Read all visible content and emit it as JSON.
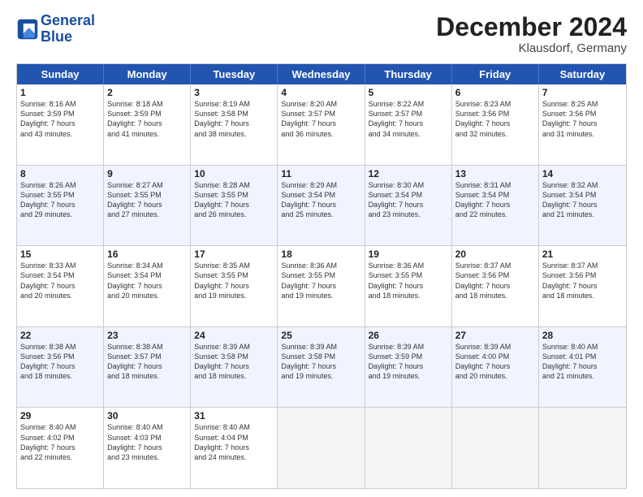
{
  "header": {
    "logo_line1": "General",
    "logo_line2": "Blue",
    "title": "December 2024",
    "subtitle": "Klausdorf, Germany"
  },
  "weekdays": [
    "Sunday",
    "Monday",
    "Tuesday",
    "Wednesday",
    "Thursday",
    "Friday",
    "Saturday"
  ],
  "rows": [
    [
      {
        "day": "1",
        "l1": "Sunrise: 8:16 AM",
        "l2": "Sunset: 3:59 PM",
        "l3": "Daylight: 7 hours",
        "l4": "and 43 minutes."
      },
      {
        "day": "2",
        "l1": "Sunrise: 8:18 AM",
        "l2": "Sunset: 3:59 PM",
        "l3": "Daylight: 7 hours",
        "l4": "and 41 minutes."
      },
      {
        "day": "3",
        "l1": "Sunrise: 8:19 AM",
        "l2": "Sunset: 3:58 PM",
        "l3": "Daylight: 7 hours",
        "l4": "and 38 minutes."
      },
      {
        "day": "4",
        "l1": "Sunrise: 8:20 AM",
        "l2": "Sunset: 3:57 PM",
        "l3": "Daylight: 7 hours",
        "l4": "and 36 minutes."
      },
      {
        "day": "5",
        "l1": "Sunrise: 8:22 AM",
        "l2": "Sunset: 3:57 PM",
        "l3": "Daylight: 7 hours",
        "l4": "and 34 minutes."
      },
      {
        "day": "6",
        "l1": "Sunrise: 8:23 AM",
        "l2": "Sunset: 3:56 PM",
        "l3": "Daylight: 7 hours",
        "l4": "and 32 minutes."
      },
      {
        "day": "7",
        "l1": "Sunrise: 8:25 AM",
        "l2": "Sunset: 3:56 PM",
        "l3": "Daylight: 7 hours",
        "l4": "and 31 minutes."
      }
    ],
    [
      {
        "day": "8",
        "l1": "Sunrise: 8:26 AM",
        "l2": "Sunset: 3:55 PM",
        "l3": "Daylight: 7 hours",
        "l4": "and 29 minutes."
      },
      {
        "day": "9",
        "l1": "Sunrise: 8:27 AM",
        "l2": "Sunset: 3:55 PM",
        "l3": "Daylight: 7 hours",
        "l4": "and 27 minutes."
      },
      {
        "day": "10",
        "l1": "Sunrise: 8:28 AM",
        "l2": "Sunset: 3:55 PM",
        "l3": "Daylight: 7 hours",
        "l4": "and 26 minutes."
      },
      {
        "day": "11",
        "l1": "Sunrise: 8:29 AM",
        "l2": "Sunset: 3:54 PM",
        "l3": "Daylight: 7 hours",
        "l4": "and 25 minutes."
      },
      {
        "day": "12",
        "l1": "Sunrise: 8:30 AM",
        "l2": "Sunset: 3:54 PM",
        "l3": "Daylight: 7 hours",
        "l4": "and 23 minutes."
      },
      {
        "day": "13",
        "l1": "Sunrise: 8:31 AM",
        "l2": "Sunset: 3:54 PM",
        "l3": "Daylight: 7 hours",
        "l4": "and 22 minutes."
      },
      {
        "day": "14",
        "l1": "Sunrise: 8:32 AM",
        "l2": "Sunset: 3:54 PM",
        "l3": "Daylight: 7 hours",
        "l4": "and 21 minutes."
      }
    ],
    [
      {
        "day": "15",
        "l1": "Sunrise: 8:33 AM",
        "l2": "Sunset: 3:54 PM",
        "l3": "Daylight: 7 hours",
        "l4": "and 20 minutes."
      },
      {
        "day": "16",
        "l1": "Sunrise: 8:34 AM",
        "l2": "Sunset: 3:54 PM",
        "l3": "Daylight: 7 hours",
        "l4": "and 20 minutes."
      },
      {
        "day": "17",
        "l1": "Sunrise: 8:35 AM",
        "l2": "Sunset: 3:55 PM",
        "l3": "Daylight: 7 hours",
        "l4": "and 19 minutes."
      },
      {
        "day": "18",
        "l1": "Sunrise: 8:36 AM",
        "l2": "Sunset: 3:55 PM",
        "l3": "Daylight: 7 hours",
        "l4": "and 19 minutes."
      },
      {
        "day": "19",
        "l1": "Sunrise: 8:36 AM",
        "l2": "Sunset: 3:55 PM",
        "l3": "Daylight: 7 hours",
        "l4": "and 18 minutes."
      },
      {
        "day": "20",
        "l1": "Sunrise: 8:37 AM",
        "l2": "Sunset: 3:56 PM",
        "l3": "Daylight: 7 hours",
        "l4": "and 18 minutes."
      },
      {
        "day": "21",
        "l1": "Sunrise: 8:37 AM",
        "l2": "Sunset: 3:56 PM",
        "l3": "Daylight: 7 hours",
        "l4": "and 18 minutes."
      }
    ],
    [
      {
        "day": "22",
        "l1": "Sunrise: 8:38 AM",
        "l2": "Sunset: 3:56 PM",
        "l3": "Daylight: 7 hours",
        "l4": "and 18 minutes."
      },
      {
        "day": "23",
        "l1": "Sunrise: 8:38 AM",
        "l2": "Sunset: 3:57 PM",
        "l3": "Daylight: 7 hours",
        "l4": "and 18 minutes."
      },
      {
        "day": "24",
        "l1": "Sunrise: 8:39 AM",
        "l2": "Sunset: 3:58 PM",
        "l3": "Daylight: 7 hours",
        "l4": "and 18 minutes."
      },
      {
        "day": "25",
        "l1": "Sunrise: 8:39 AM",
        "l2": "Sunset: 3:58 PM",
        "l3": "Daylight: 7 hours",
        "l4": "and 19 minutes."
      },
      {
        "day": "26",
        "l1": "Sunrise: 8:39 AM",
        "l2": "Sunset: 3:59 PM",
        "l3": "Daylight: 7 hours",
        "l4": "and 19 minutes."
      },
      {
        "day": "27",
        "l1": "Sunrise: 8:39 AM",
        "l2": "Sunset: 4:00 PM",
        "l3": "Daylight: 7 hours",
        "l4": "and 20 minutes."
      },
      {
        "day": "28",
        "l1": "Sunrise: 8:40 AM",
        "l2": "Sunset: 4:01 PM",
        "l3": "Daylight: 7 hours",
        "l4": "and 21 minutes."
      }
    ],
    [
      {
        "day": "29",
        "l1": "Sunrise: 8:40 AM",
        "l2": "Sunset: 4:02 PM",
        "l3": "Daylight: 7 hours",
        "l4": "and 22 minutes."
      },
      {
        "day": "30",
        "l1": "Sunrise: 8:40 AM",
        "l2": "Sunset: 4:03 PM",
        "l3": "Daylight: 7 hours",
        "l4": "and 23 minutes."
      },
      {
        "day": "31",
        "l1": "Sunrise: 8:40 AM",
        "l2": "Sunset: 4:04 PM",
        "l3": "Daylight: 7 hours",
        "l4": "and 24 minutes."
      },
      {
        "day": "",
        "l1": "",
        "l2": "",
        "l3": "",
        "l4": ""
      },
      {
        "day": "",
        "l1": "",
        "l2": "",
        "l3": "",
        "l4": ""
      },
      {
        "day": "",
        "l1": "",
        "l2": "",
        "l3": "",
        "l4": ""
      },
      {
        "day": "",
        "l1": "",
        "l2": "",
        "l3": "",
        "l4": ""
      }
    ]
  ]
}
